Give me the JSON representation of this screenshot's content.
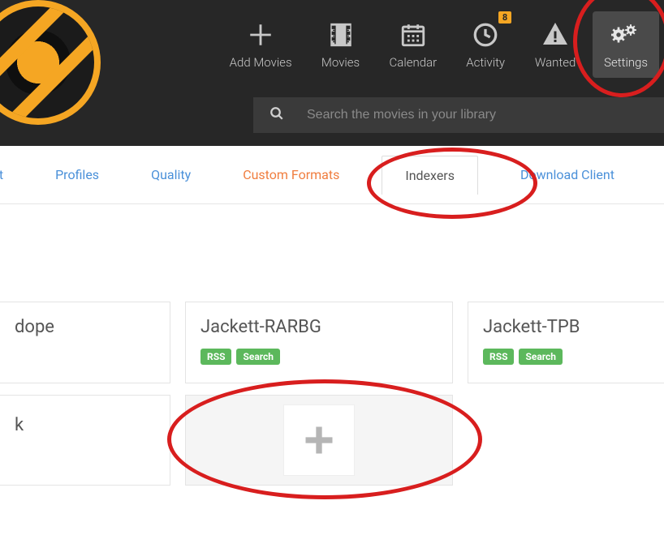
{
  "header": {
    "nav": {
      "add_movies": "Add Movies",
      "movies": "Movies",
      "calendar": "Calendar",
      "activity": "Activity",
      "activity_badge": "8",
      "wanted": "Wanted",
      "settings": "Settings"
    },
    "search": {
      "placeholder": "Search the movies in your library"
    }
  },
  "tabs": {
    "partial_left": "nt",
    "profiles": "Profiles",
    "quality": "Quality",
    "custom_formats": "Custom Formats",
    "indexers": "Indexers",
    "download_client": "Download Client"
  },
  "indexers": {
    "items": [
      {
        "name": "dope"
      },
      {
        "name": "Jackett-RARBG",
        "badges": [
          "RSS",
          "Search"
        ]
      },
      {
        "name": "Jackett-TPB",
        "badges": [
          "RSS",
          "Search"
        ]
      }
    ],
    "row2_partial": "k"
  },
  "colors": {
    "accent": "#f5a623",
    "link": "#4a90d9",
    "custom_formats": "#f07d3e",
    "badge_green": "#5cb85c"
  }
}
